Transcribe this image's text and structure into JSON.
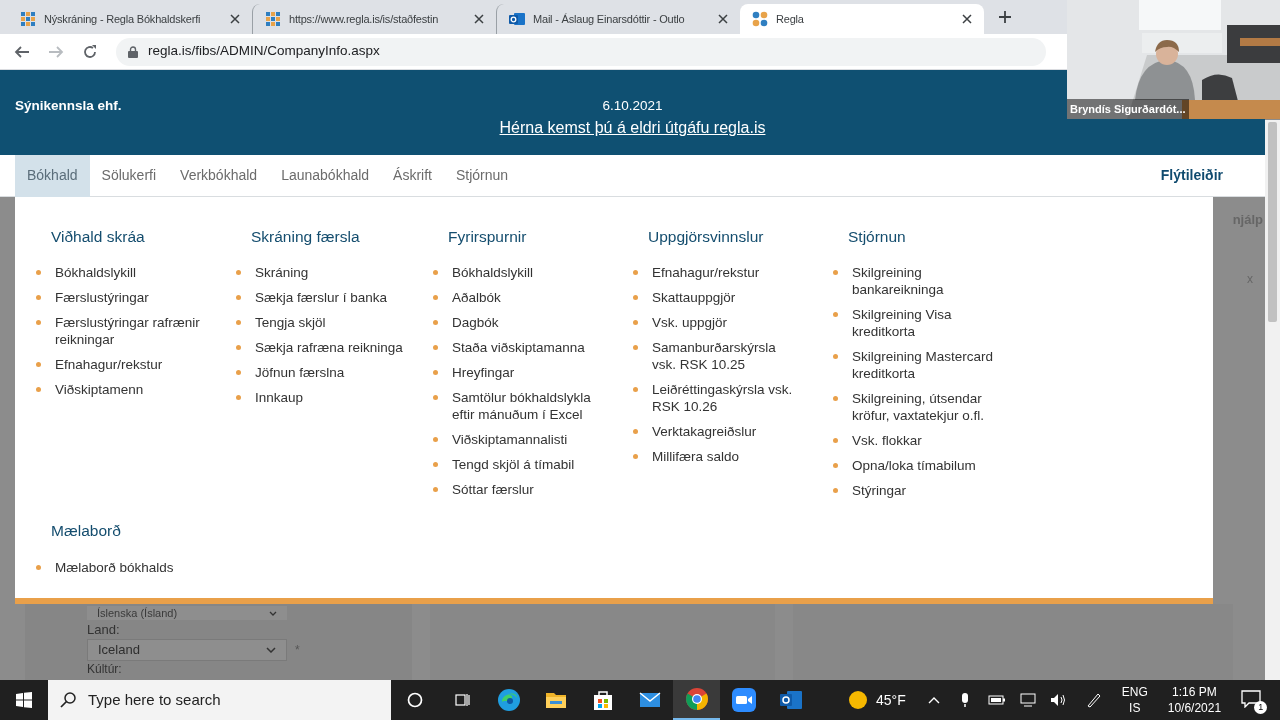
{
  "browser": {
    "tabs": [
      {
        "title": "Nýskráning - Regla Bókhaldskerfi",
        "kind": "grid",
        "selected": false
      },
      {
        "title": "https://www.regla.is/is/staðfestin",
        "kind": "grid",
        "selected": false
      },
      {
        "title": "Mail - Áslaug Einarsdóttir - Outlo",
        "kind": "mail",
        "selected": false
      },
      {
        "title": "Regla",
        "kind": "dots",
        "selected": true
      }
    ],
    "address": "regla.is/fibs/ADMIN/CompanyInfo.aspx"
  },
  "video_overlay": {
    "name": "Bryndís Sigurðardót..."
  },
  "header": {
    "company": "Sýnikennsla ehf.",
    "date": "6.10.2021",
    "link": "Hérna kemst þú á eldri útgáfu regla.is"
  },
  "nav": {
    "items": [
      {
        "label": "Bókhald",
        "selected": true
      },
      {
        "label": "Sölukerfi",
        "selected": false
      },
      {
        "label": "Verkbókhald",
        "selected": false
      },
      {
        "label": "Launabókhald",
        "selected": false
      },
      {
        "label": "Áskrift",
        "selected": false
      },
      {
        "label": "Stjórnun",
        "selected": false
      }
    ],
    "shortcuts": "Flýtileiðir"
  },
  "menu": {
    "sections": [
      {
        "heading": "Viðhald skráa",
        "items": [
          "Bókhaldslykill",
          "Færslustýringar",
          "Færslustýringar rafrænir reikningar",
          "Efnahagur/rekstur",
          "Viðskiptamenn"
        ]
      },
      {
        "heading": "Skráning færsla",
        "items": [
          "Skráning",
          "Sækja færslur í banka",
          "Tengja skjöl",
          "Sækja rafræna reikninga",
          "Jöfnun færslna",
          "Innkaup"
        ]
      },
      {
        "heading": "Fyrirspurnir",
        "items": [
          "Bókhaldslykill",
          "Aðalbók",
          "Dagbók",
          "Staða viðskiptamanna",
          "Hreyfingar",
          "Samtölur bókhaldslykla eftir mánuðum í Excel",
          "Viðskiptamannalisti",
          "Tengd skjöl á tímabil",
          "Sóttar færslur"
        ]
      },
      {
        "heading": "Uppgjörsvinnslur",
        "items": [
          "Efnahagur/rekstur",
          "Skattauppgjör",
          "Vsk. uppgjör",
          "Samanburðarskýrsla vsk. RSK 10.25",
          "Leiðréttingaskýrsla vsk. RSK 10.26",
          "Verktakagreiðslur",
          "Millifæra saldo"
        ]
      },
      {
        "heading": "Stjórnun",
        "items": [
          "Skilgreining bankareikninga",
          "Skilgreining Visa kreditkorta",
          "Skilgreining Mastercard kreditkorta",
          "Skilgreining, útsendar kröfur, vaxtatekjur o.fl.",
          "Vsk. flokkar",
          "Opna/loka tímabilum",
          "Stýringar"
        ]
      },
      {
        "heading": "Mælaborð",
        "items": [
          "Mælaborð bókhalds"
        ]
      }
    ]
  },
  "background": {
    "help": "njálp",
    "close": "x",
    "language_select": "Íslenska (Ísland)",
    "country_label": "Land:",
    "country_select": "Iceland",
    "required_mark": "*",
    "culture_label": "Kúltúr:"
  },
  "taskbar": {
    "search_placeholder": "Type here to search",
    "apps": [
      {
        "kind": "edge",
        "selected": false
      },
      {
        "kind": "folder",
        "selected": false
      },
      {
        "kind": "store",
        "selected": false
      },
      {
        "kind": "mail",
        "selected": false
      },
      {
        "kind": "chrome",
        "selected": true
      },
      {
        "kind": "zoom",
        "selected": false
      },
      {
        "kind": "outlook",
        "selected": false
      }
    ],
    "temperature": "45°F",
    "language": "ENG",
    "layout": "IS",
    "time": "1:16 PM",
    "date": "10/6/2021",
    "notifications": "1"
  }
}
